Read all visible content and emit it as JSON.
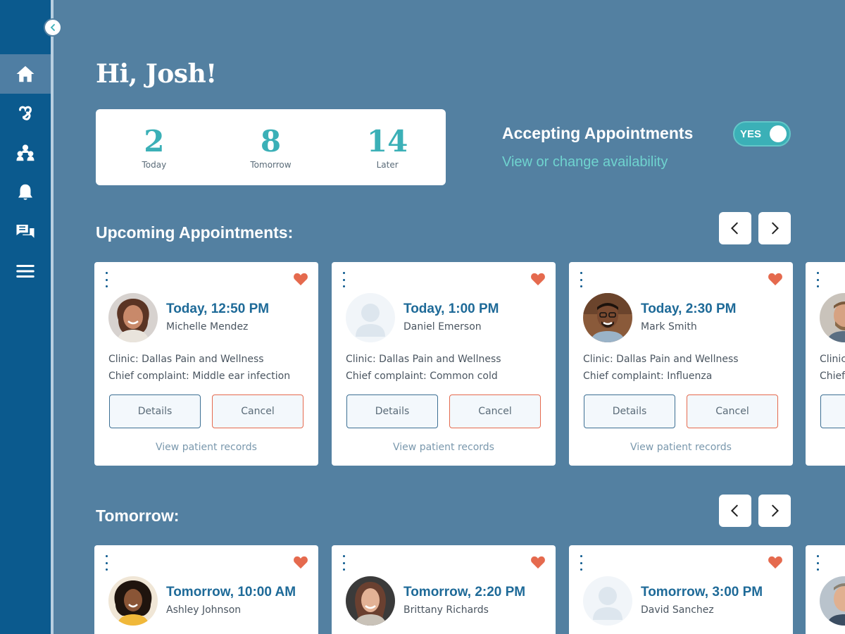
{
  "greeting": "Hi, Josh!",
  "stats": [
    {
      "value": "2",
      "label": "Today"
    },
    {
      "value": "8",
      "label": "Tomorrow"
    },
    {
      "value": "14",
      "label": "Later"
    }
  ],
  "availability": {
    "title": "Accepting Appointments",
    "link": "View or change availability",
    "toggle_label": "YES"
  },
  "sections": {
    "upcoming_title": "Upcoming Appointments:",
    "tomorrow_title": "Tomorrow:"
  },
  "upcoming": [
    {
      "time": "Today, 12:50 PM",
      "patient": "Michelle Mendez",
      "clinic": "Clinic: Dallas Pain and Wellness",
      "complaint": "Chief complaint: Middle ear infection",
      "details_label": "Details",
      "cancel_label": "Cancel",
      "records_label": "View patient records"
    },
    {
      "time": "Today, 1:00 PM",
      "patient": "Daniel Emerson",
      "clinic": "Clinic: Dallas Pain and Wellness",
      "complaint": "Chief complaint: Common cold",
      "details_label": "Details",
      "cancel_label": "Cancel",
      "records_label": "View patient records"
    },
    {
      "time": "Today, 2:30 PM",
      "patient": "Mark Smith",
      "clinic": "Clinic: Dallas Pain and Wellness",
      "complaint": "Chief complaint: Influenza",
      "details_label": "Details",
      "cancel_label": "Cancel",
      "records_label": "View patient records"
    },
    {
      "clinic": "Clinic",
      "complaint": "Chief"
    }
  ],
  "tomorrow": [
    {
      "time": "Tomorrow, 10:00 AM",
      "patient": "Ashley Johnson"
    },
    {
      "time": "Tomorrow, 2:20 PM",
      "patient": "Brittany Richards"
    },
    {
      "time": "Tomorrow, 3:00 PM",
      "patient": "David Sanchez"
    }
  ],
  "colors": {
    "background": "#5380a1",
    "sidebar": "#0b5a8e",
    "accent_teal": "#3bb0b7",
    "heart": "#e56a4e",
    "time_text": "#1e6a98"
  },
  "nav_icons": [
    "home-icon",
    "link-icon",
    "people-icon",
    "bell-icon",
    "chat-icon",
    "menu-icon"
  ]
}
